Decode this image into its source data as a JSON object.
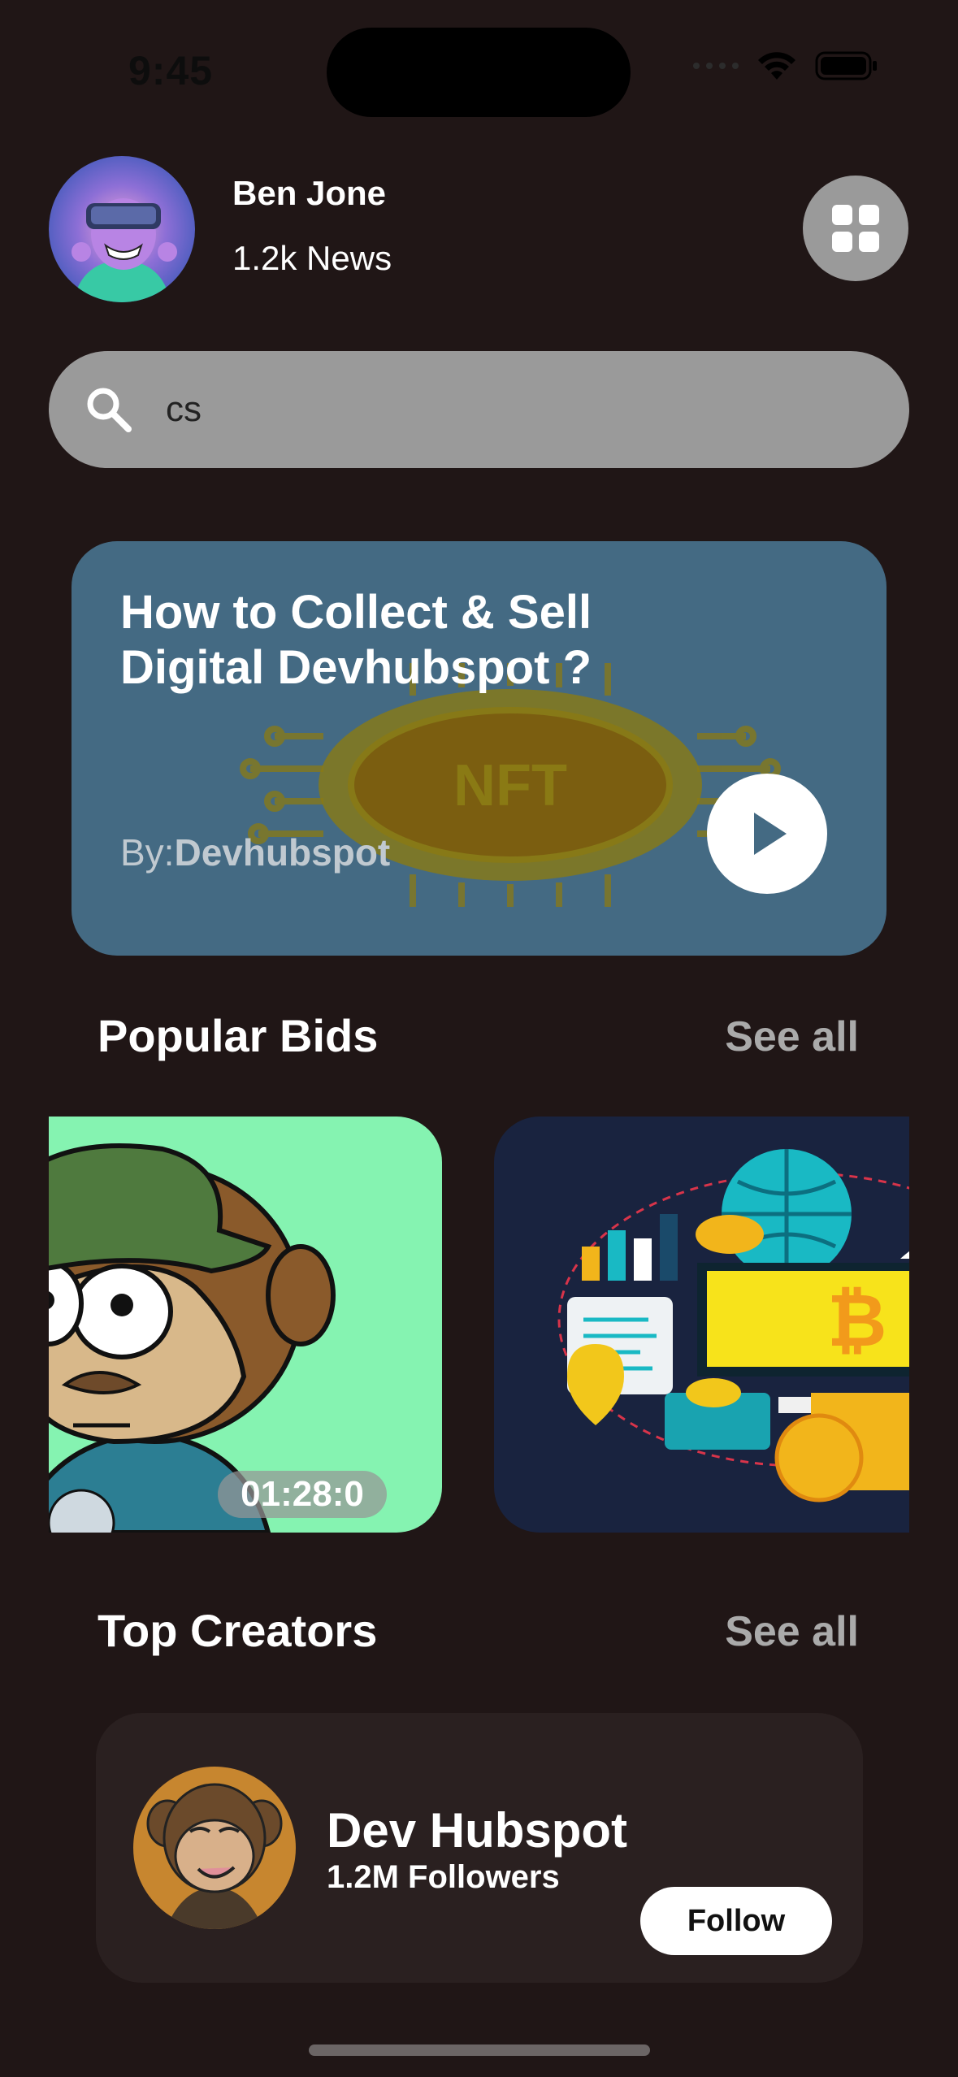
{
  "status_bar": {
    "time": "9:45"
  },
  "profile": {
    "name": "Ben Jone",
    "subtitle": "1.2k News"
  },
  "search": {
    "value": "cs"
  },
  "banner": {
    "title": "How to Collect & Sell Digital Devhubspot ?",
    "by_prefix": "By:",
    "by_name": "Devhubspot",
    "art_text": "NFT"
  },
  "popular_bids": {
    "title": "Popular Bids",
    "see_all": "See all",
    "cards": [
      {
        "timer": "01:28:0"
      },
      {
        "timer": ""
      }
    ]
  },
  "top_creators": {
    "title": "Top Creators",
    "see_all": "See all",
    "creator": {
      "name": "Dev Hubspot",
      "followers": "1.2M Followers",
      "follow_label": "Follow"
    }
  },
  "colors": {
    "background": "#201616",
    "banner": "#446a83",
    "search": "#9a9a9a",
    "card": "#2a2020",
    "see_all": "#aaaaaa"
  }
}
